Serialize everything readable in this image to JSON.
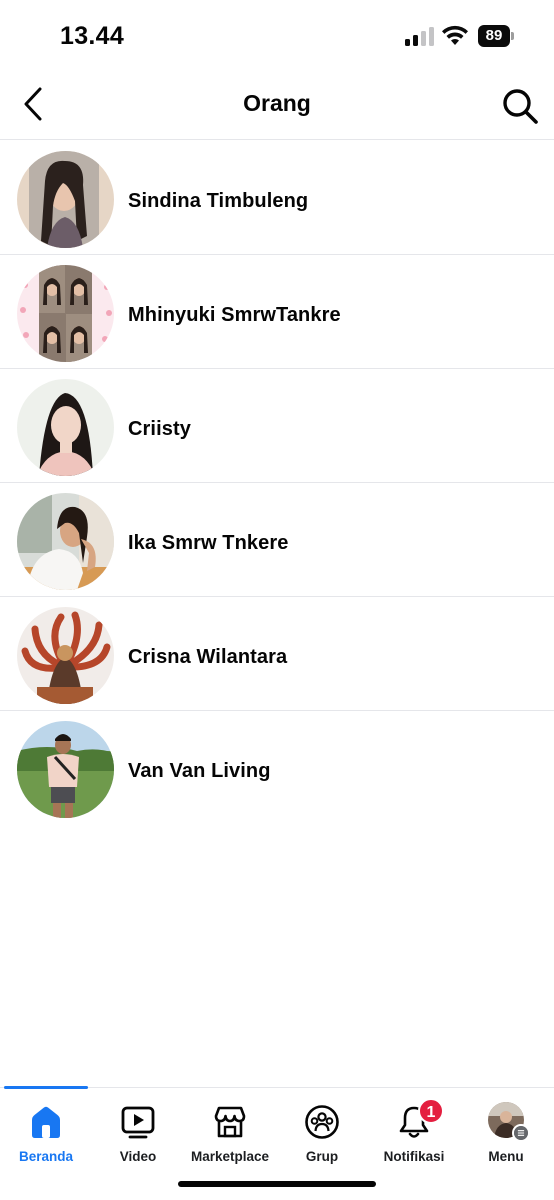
{
  "status_bar": {
    "time": "13.44",
    "battery": "89"
  },
  "header": {
    "title": "Orang",
    "back_icon": "chevron-left-icon",
    "search_icon": "search-icon"
  },
  "people": [
    {
      "name": "Sindina Timbuleng"
    },
    {
      "name": "Mhinyuki SmrwTankre"
    },
    {
      "name": "Criisty"
    },
    {
      "name": "Ika Smrw Tnkere"
    },
    {
      "name": "Crisna Wilantara"
    },
    {
      "name": "Van Van Living"
    }
  ],
  "bottom_nav": {
    "items": [
      {
        "label": "Beranda",
        "icon": "home-icon",
        "active": true
      },
      {
        "label": "Video",
        "icon": "video-icon"
      },
      {
        "label": "Marketplace",
        "icon": "marketplace-icon"
      },
      {
        "label": "Grup",
        "icon": "groups-icon"
      },
      {
        "label": "Notifikasi",
        "icon": "bell-icon",
        "badge": "1"
      },
      {
        "label": "Menu",
        "icon": "menu-avatar-icon"
      }
    ]
  },
  "colors": {
    "accent": "#1877f2",
    "badge": "#e41e3f",
    "divider": "#e5e6ea"
  }
}
